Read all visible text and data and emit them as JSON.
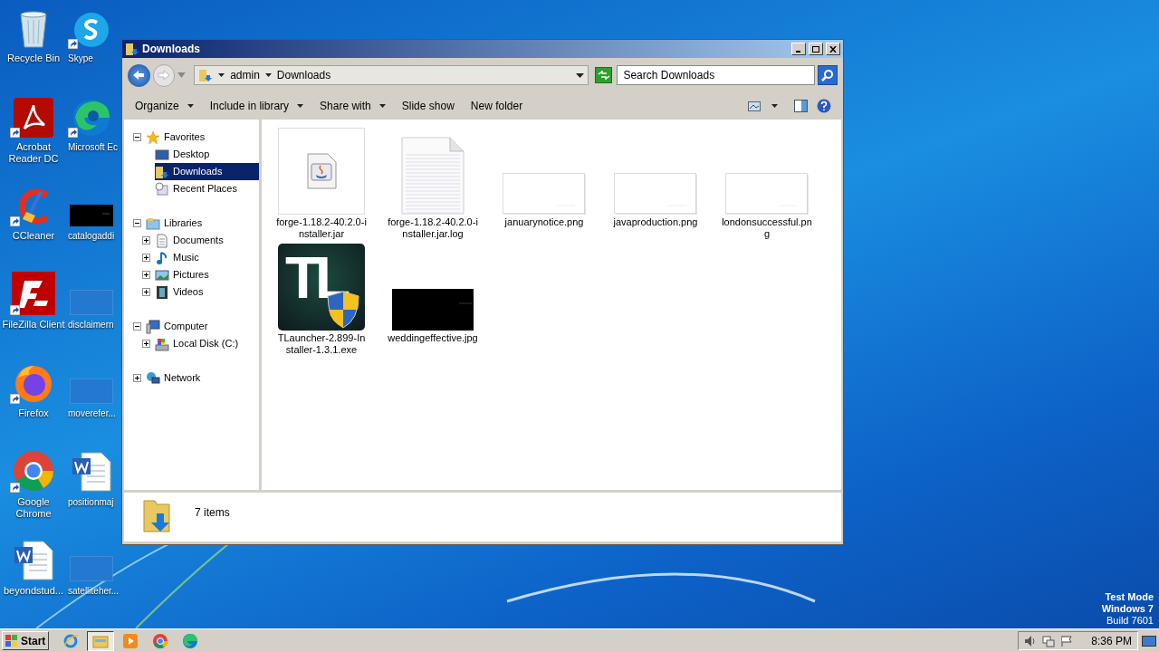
{
  "desktop": {
    "icons": [
      {
        "label": "Recycle Bin",
        "kind": "recycle",
        "shortcut": false
      },
      {
        "label": "Skype",
        "kind": "skype",
        "shortcut": true
      },
      {
        "label": "Acrobat Reader DC",
        "kind": "acrobat",
        "shortcut": true
      },
      {
        "label": "Microsoft Ec",
        "kind": "edge",
        "shortcut": true
      },
      {
        "label": "CCleaner",
        "kind": "ccleaner",
        "shortcut": true
      },
      {
        "label": "catalogaddi",
        "kind": "dark-thumb",
        "shortcut": false
      },
      {
        "label": "FileZilla Client",
        "kind": "filezilla",
        "shortcut": true
      },
      {
        "label": "disclaimern",
        "kind": "blank-thumb",
        "shortcut": false
      },
      {
        "label": "Firefox",
        "kind": "firefox",
        "shortcut": true
      },
      {
        "label": "moverefer...",
        "kind": "blank-thumb",
        "shortcut": false
      },
      {
        "label": "Google Chrome",
        "kind": "chrome",
        "shortcut": true
      },
      {
        "label": "positionmaj",
        "kind": "word",
        "shortcut": false
      },
      {
        "label": "beyondstud...",
        "kind": "word",
        "shortcut": false
      },
      {
        "label": "satelliteher...",
        "kind": "blank-thumb",
        "shortcut": false
      }
    ]
  },
  "window": {
    "title": "Downloads",
    "breadcrumb": [
      "admin",
      "Downloads"
    ],
    "search": {
      "placeholder": "Search Downloads"
    },
    "toolbar": [
      {
        "label": "Organize",
        "dropdown": true
      },
      {
        "label": "Include in library",
        "dropdown": true
      },
      {
        "label": "Share with",
        "dropdown": true
      },
      {
        "label": "Slide show",
        "dropdown": false
      },
      {
        "label": "New folder",
        "dropdown": false
      }
    ],
    "nav": [
      {
        "label": "Favorites",
        "kind": "star",
        "expanded": true,
        "selected": false,
        "children": [
          {
            "label": "Desktop",
            "kind": "desktop",
            "selected": false
          },
          {
            "label": "Downloads",
            "kind": "downloads",
            "selected": true
          },
          {
            "label": "Recent Places",
            "kind": "recent",
            "selected": false
          }
        ]
      },
      {
        "label": "Libraries",
        "kind": "libraries",
        "expanded": true,
        "selected": false,
        "children": [
          {
            "label": "Documents",
            "kind": "documents",
            "expanded": false,
            "selected": false
          },
          {
            "label": "Music",
            "kind": "music",
            "expanded": false,
            "selected": false
          },
          {
            "label": "Pictures",
            "kind": "pictures",
            "expanded": false,
            "selected": false
          },
          {
            "label": "Videos",
            "kind": "videos",
            "expanded": false,
            "selected": false
          }
        ]
      },
      {
        "label": "Computer",
        "kind": "computer",
        "expanded": true,
        "selected": false,
        "children": [
          {
            "label": "Local Disk (C:)",
            "kind": "disk",
            "expanded": false,
            "selected": false
          }
        ]
      },
      {
        "label": "Network",
        "kind": "network",
        "expanded": false,
        "selected": false
      }
    ],
    "files": [
      {
        "name": "forge-1.18.2-40.2.0-installer.jar",
        "kind": "jar"
      },
      {
        "name": "forge-1.18.2-40.2.0-installer.jar.log",
        "kind": "log"
      },
      {
        "name": "januarynotice.png",
        "kind": "png"
      },
      {
        "name": "javaproduction.png",
        "kind": "png"
      },
      {
        "name": "londonsuccessful.png",
        "kind": "png"
      },
      {
        "name": "TLauncher-2.899-Installer-1.3.1.exe",
        "kind": "exe",
        "icon_text": "TL"
      },
      {
        "name": "weddingeffective.jpg",
        "kind": "jpg"
      }
    ],
    "status": "7 items"
  },
  "taskbar": {
    "start": "Start",
    "apps": [
      {
        "kind": "ie",
        "selected": false
      },
      {
        "kind": "explorer",
        "selected": true
      },
      {
        "kind": "media",
        "selected": false
      },
      {
        "kind": "chrome",
        "selected": false
      },
      {
        "kind": "edge",
        "selected": false
      }
    ],
    "clock": "8:36 PM"
  },
  "os_notice": [
    "Test Mode",
    "Windows 7",
    "Build 7601"
  ]
}
